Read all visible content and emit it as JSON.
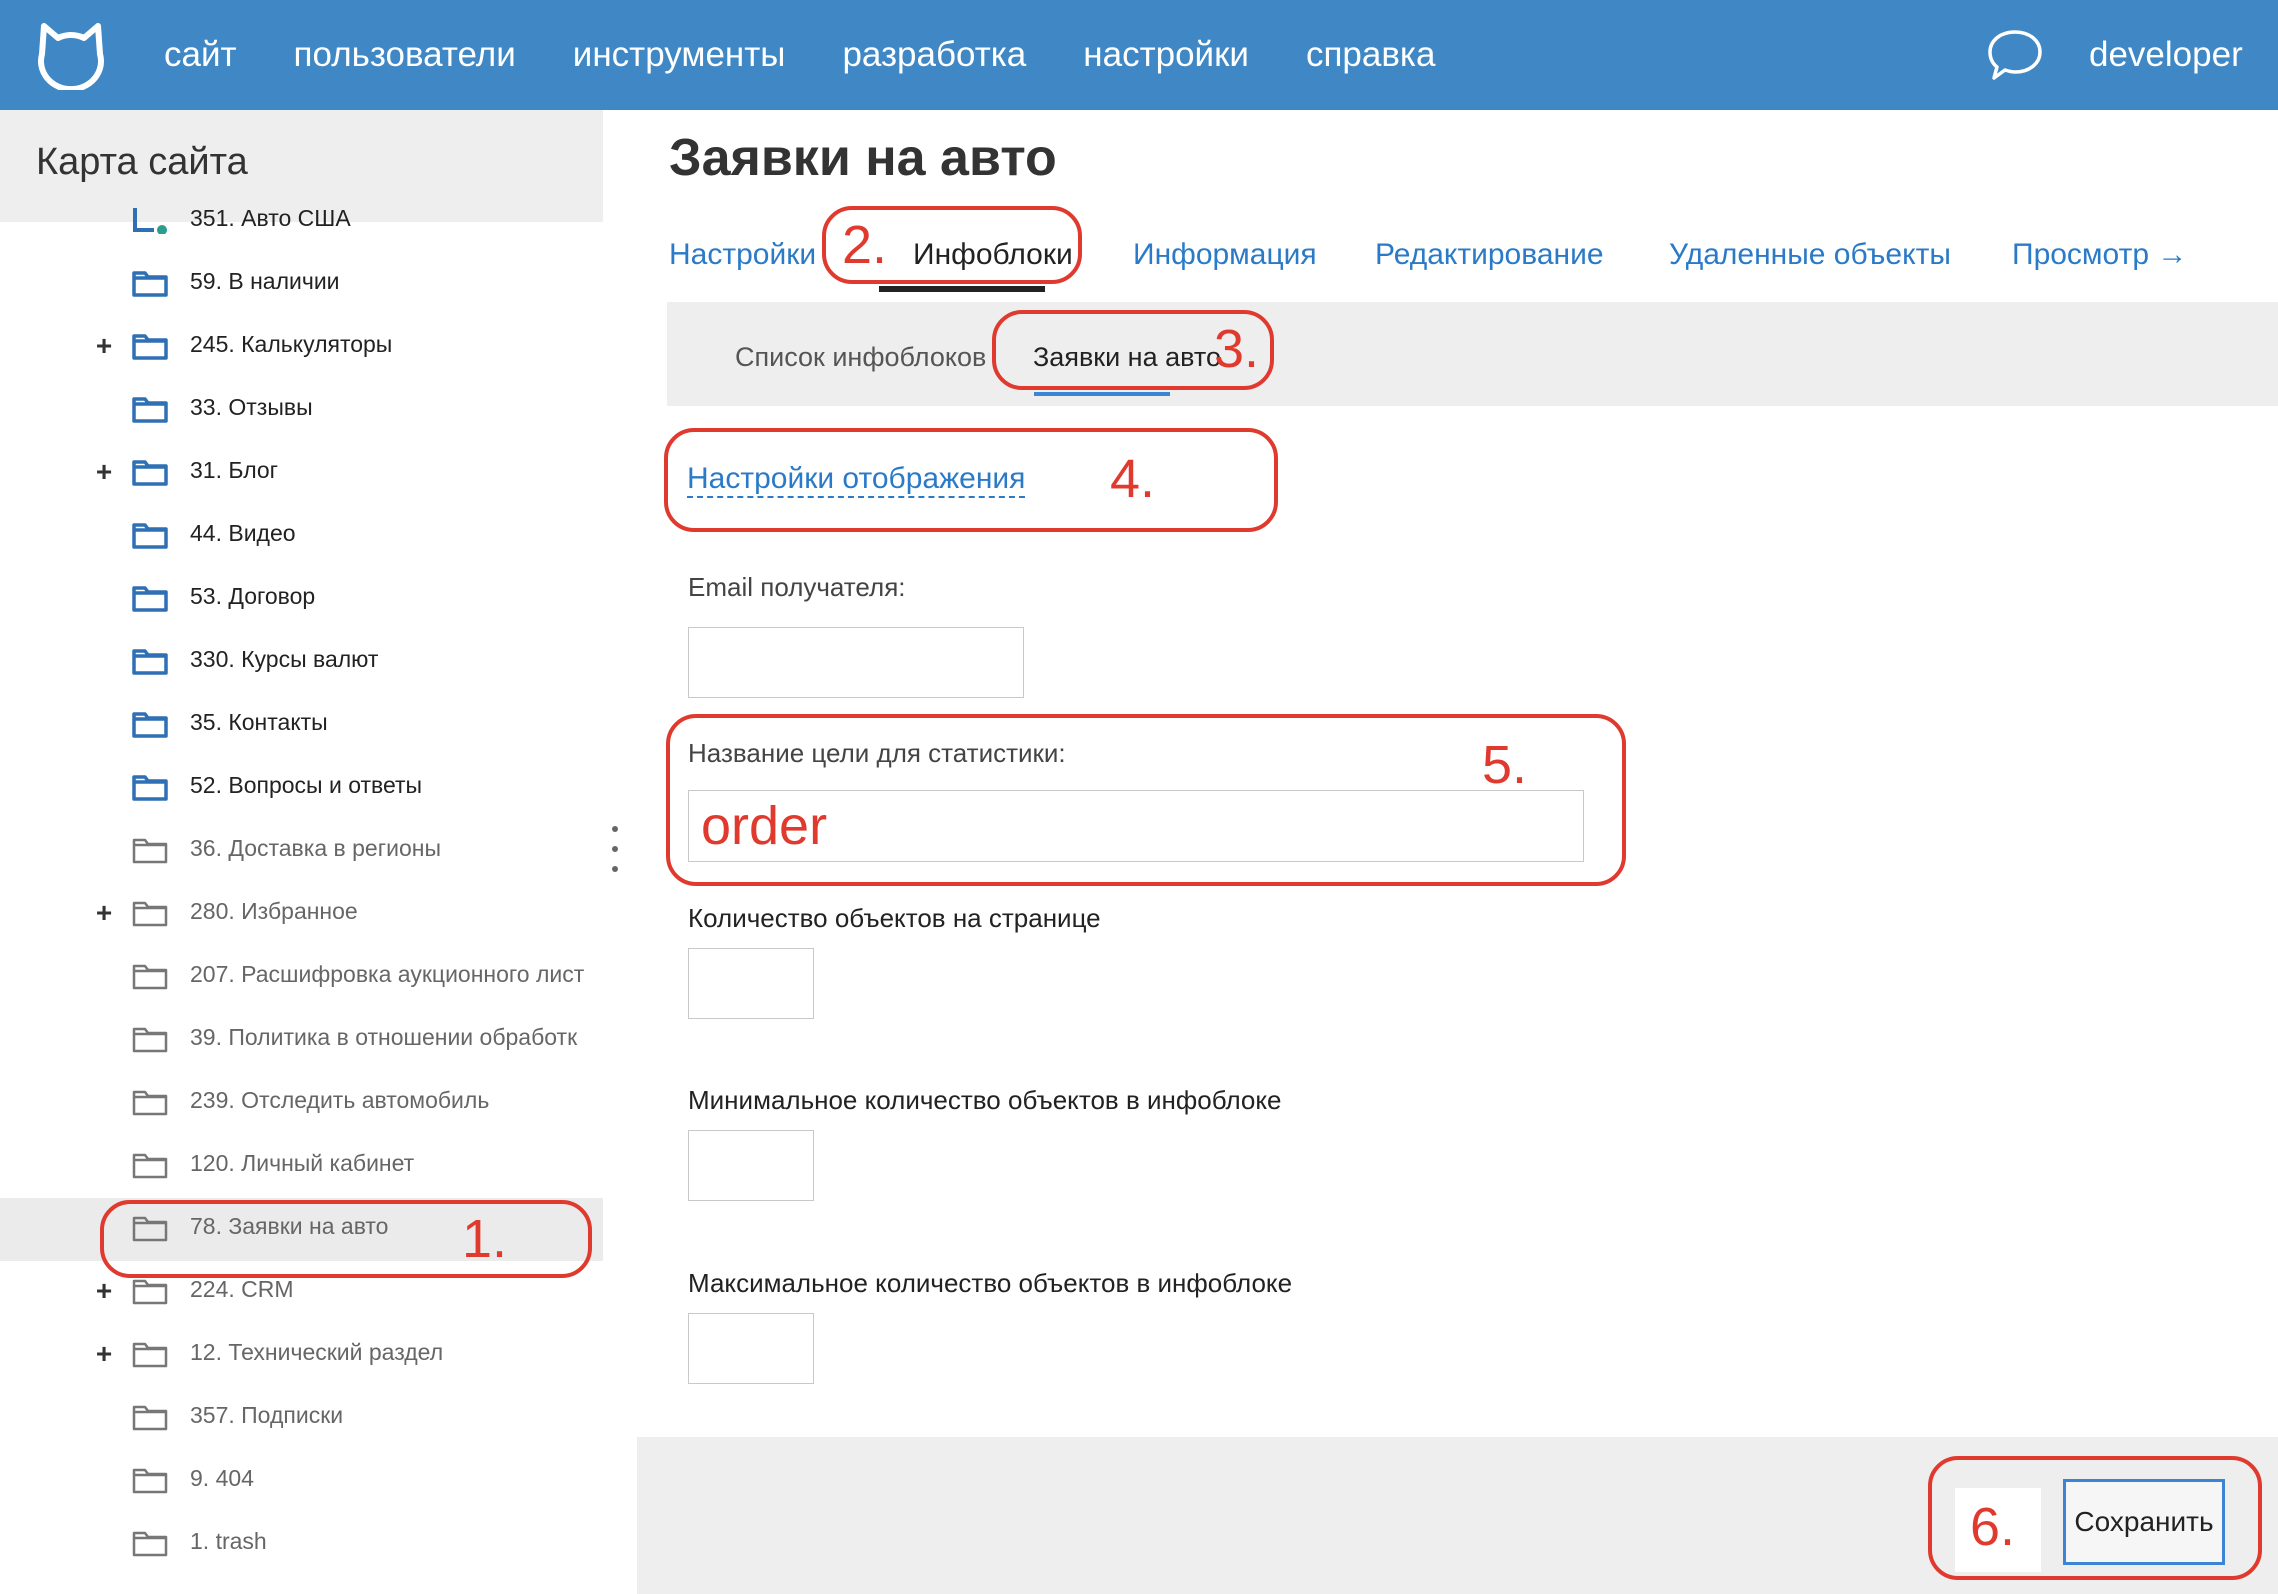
{
  "topbar": {
    "nav": [
      "сайт",
      "пользователи",
      "инструменты",
      "разработка",
      "настройки",
      "справка"
    ],
    "user": "developer"
  },
  "sidebar": {
    "title": "Карта сайта",
    "items": [
      {
        "label": "351. Авто США",
        "plus": false,
        "style": "blue-special"
      },
      {
        "label": "59. В наличии",
        "plus": false,
        "style": "blue"
      },
      {
        "label": "245. Калькуляторы",
        "plus": true,
        "style": "blue"
      },
      {
        "label": "33. Отзывы",
        "plus": false,
        "style": "blue"
      },
      {
        "label": "31. Блог",
        "plus": true,
        "style": "blue"
      },
      {
        "label": "44. Видео",
        "plus": false,
        "style": "blue"
      },
      {
        "label": "53. Договор",
        "plus": false,
        "style": "blue"
      },
      {
        "label": "330. Курсы валют",
        "plus": false,
        "style": "blue"
      },
      {
        "label": "35. Контакты",
        "plus": false,
        "style": "blue"
      },
      {
        "label": "52. Вопросы и ответы",
        "plus": false,
        "style": "blue"
      },
      {
        "label": "36. Доставка в регионы",
        "plus": false,
        "style": "gray"
      },
      {
        "label": "280. Избранное",
        "plus": true,
        "style": "gray"
      },
      {
        "label": "207. Расшифровка аукционного лист",
        "plus": false,
        "style": "gray"
      },
      {
        "label": "39. Политика в отношении обработк",
        "plus": false,
        "style": "gray"
      },
      {
        "label": "239. Отследить автомобиль",
        "plus": false,
        "style": "gray"
      },
      {
        "label": "120. Личный кабинет",
        "plus": false,
        "style": "gray"
      },
      {
        "label": "78. Заявки на авто",
        "plus": false,
        "style": "gray",
        "selected": true
      },
      {
        "label": "224. CRM",
        "plus": true,
        "style": "gray"
      },
      {
        "label": "12. Технический раздел",
        "plus": true,
        "style": "gray"
      },
      {
        "label": "357. Подписки",
        "plus": false,
        "style": "gray"
      },
      {
        "label": "9. 404",
        "plus": false,
        "style": "gray"
      },
      {
        "label": "1. trash",
        "plus": false,
        "style": "gray"
      }
    ]
  },
  "main": {
    "title": "Заявки на авто",
    "tabs": [
      "Настройки",
      "Инфоблоки",
      "Информация",
      "Редактирование",
      "Удаленные объекты",
      "Просмотр →"
    ],
    "active_tab": "Инфоблоки",
    "subtabs": [
      "Список инфоблоков",
      "Заявки на авто"
    ],
    "display_settings_link": "Настройки отображения",
    "fields": {
      "email_label": "Email получателя:",
      "email_value": "",
      "goal_label": "Название цели для статистики:",
      "goal_value": "order",
      "per_page_label": "Количество объектов на странице",
      "per_page_value": "",
      "min_label": "Минимальное количество объектов в инфоблоке",
      "min_value": "",
      "max_label": "Максимальное количество объектов в инфоблоке",
      "max_value": ""
    },
    "save_label": "Сохранить"
  },
  "annotations": [
    "1.",
    "2.",
    "3.",
    "4.",
    "5.",
    "6."
  ],
  "colors": {
    "topbar": "#3f88c5",
    "link": "#2a7ac7",
    "annotation": "#e03a2f",
    "folder_blue": "#2f6fb3",
    "folder_gray": "#777777"
  },
  "icons": {
    "logo": "cat-logo-icon",
    "chat": "chat-bubble-icon",
    "folder": "folder-icon"
  }
}
